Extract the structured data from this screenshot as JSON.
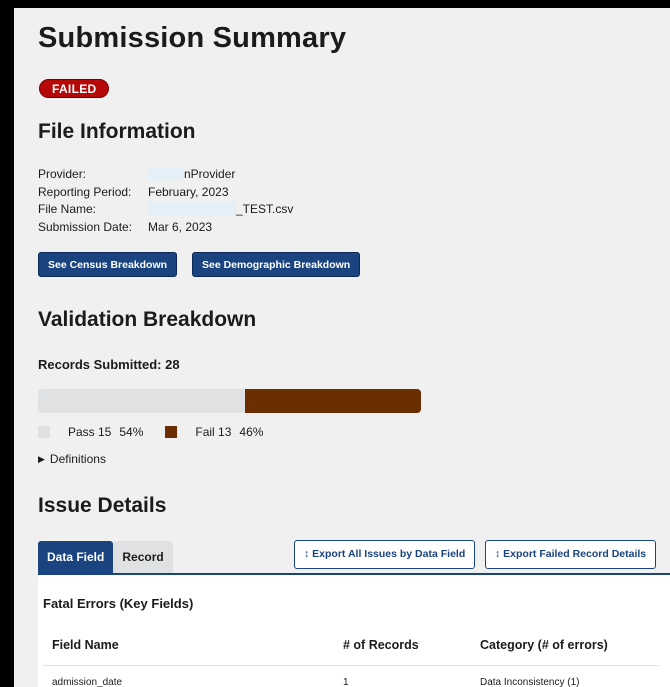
{
  "page": {
    "title": "Submission Summary",
    "status": "FAILED"
  },
  "file_info": {
    "heading": "File Information",
    "rows": [
      {
        "label": "Provider:",
        "value": "nProvider"
      },
      {
        "label": "Reporting Period:",
        "value": "February, 2023"
      },
      {
        "label": "File Name:",
        "value": "_TEST.csv"
      },
      {
        "label": "Submission Date:",
        "value": "Mar 6, 2023"
      }
    ],
    "census_button": "See Census Breakdown",
    "demographic_button": "See Demographic Breakdown"
  },
  "validation": {
    "heading": "Validation Breakdown",
    "records_submitted": "Records Submitted: 28",
    "pass_label": "Pass 15",
    "pass_pct": "54%",
    "fail_label": "Fail 13",
    "fail_pct": "46%",
    "fail_fraction": 0.46,
    "definitions": "Definitions",
    "colors": {
      "pass": "#dfe1e2",
      "fail": "#6b2e00"
    }
  },
  "issues": {
    "heading": "Issue Details",
    "tabs": [
      "Data Field",
      "Record"
    ],
    "export_by_field": "↕ Export All Issues by Data Field",
    "export_failed_records": "↕ Export Failed Record Details",
    "fatal_title": "Fatal Errors (Key Fields)",
    "columns": [
      "Field Name",
      "# of Records",
      "Category (# of errors)"
    ],
    "rows": [
      {
        "field": "admission_date",
        "records": "1",
        "category": "Data Inconsistency (1)"
      }
    ]
  },
  "colors": {
    "primary": "#1a4480",
    "failed_badge": "#b50909"
  }
}
